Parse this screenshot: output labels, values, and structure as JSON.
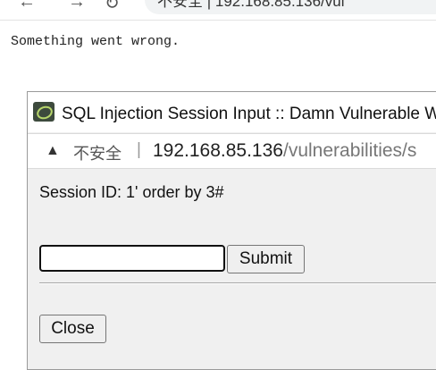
{
  "browser": {
    "back_icon": "back-arrow-icon",
    "forward_icon": "forward-arrow-icon",
    "reload_icon": "reload-icon",
    "address_partial": "不安全 | 192.168.85.136/vul"
  },
  "page": {
    "error_message": "Something went wrong."
  },
  "popup": {
    "title": "SQL Injection Session Input :: Damn Vulnerable W",
    "app_icon": "dvwa-logo-icon",
    "address": {
      "security_icon": "warning-icon",
      "security_label": "不安全",
      "separator": "|",
      "host": "192.168.85.136",
      "path": "/vulnerabilities/s"
    },
    "session_text": "Session ID: 1' order by 3#",
    "input_value": "",
    "submit_label": "Submit",
    "close_label": "Close"
  }
}
